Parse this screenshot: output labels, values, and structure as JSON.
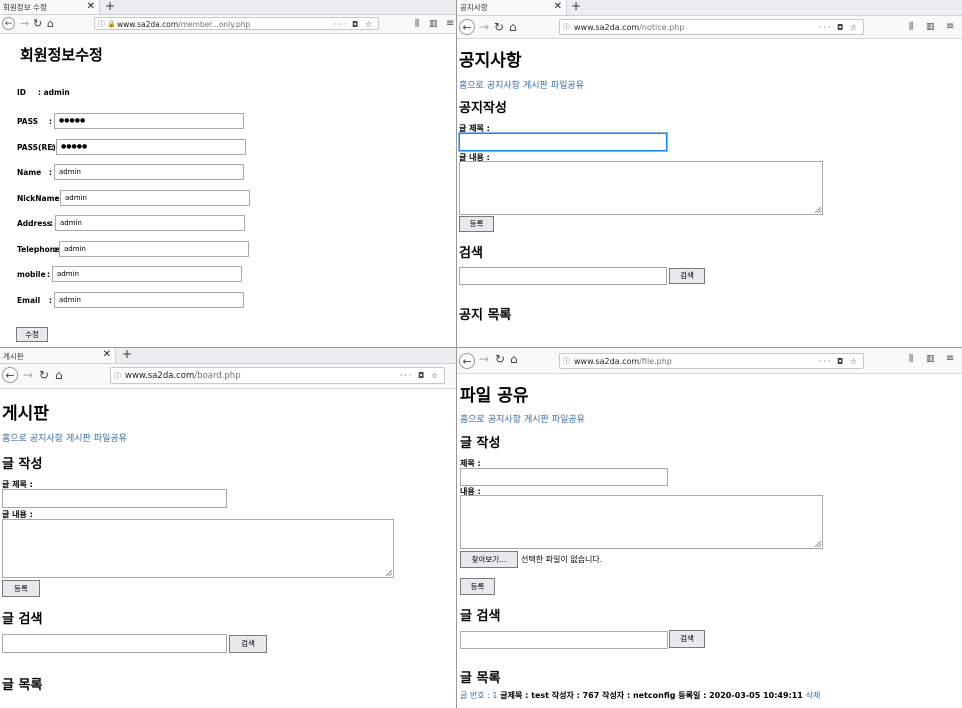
{
  "panes": {
    "member": {
      "tab_title": "회원정보 수정",
      "url_domain": "www.sa2da.com",
      "url_path": "/member...only.php",
      "page_title": "회원정보수정",
      "id_label": "ID",
      "id_value": ": admin",
      "fields": [
        {
          "label": "PASS",
          "sep": ":",
          "value": "●●●●●"
        },
        {
          "label": "PASS(RE)",
          "sep": ":",
          "value": "●●●●●"
        },
        {
          "label": "Name",
          "sep": ":",
          "value": "admin"
        },
        {
          "label": "NickName",
          "sep": ":",
          "value": "admin"
        },
        {
          "label": "Address",
          "sep": ":",
          "value": "admin"
        },
        {
          "label": "Telephone",
          "sep": ":",
          "value": "admin"
        },
        {
          "label": "mobile",
          "sep": ":",
          "value": "admin"
        },
        {
          "label": "Email",
          "sep": ":",
          "value": "admin"
        }
      ],
      "submit_label": "수정"
    },
    "notice": {
      "tab_title": "공지사항",
      "url_domain": "www.sa2da.com",
      "url_path": "/notice.php",
      "page_title": "공지사항",
      "nav": [
        "홈으로",
        "공지사항",
        "게시판",
        "파일공유"
      ],
      "write_heading": "공지작성",
      "title_label": "글 제목 :",
      "content_label": "글 내용 :",
      "submit_label": "등록",
      "search_heading": "검색",
      "search_button": "검색",
      "list_heading": "공지 목록"
    },
    "board": {
      "tab_title": "게시판",
      "url_domain": "www.sa2da.com",
      "url_path": "/board.php",
      "page_title": "게시판",
      "nav": [
        "홈으로",
        "공지사항",
        "게시판",
        "파일공유"
      ],
      "write_heading": "글 작성",
      "title_label": "글 제목 :",
      "content_label": "글 내용 :",
      "submit_label": "등록",
      "search_heading": "글 검색",
      "search_button": "검색",
      "list_heading": "글 목록"
    },
    "file": {
      "url_domain": "www.sa2da.com",
      "url_path": "/file.php",
      "page_title": "파일 공유",
      "nav": [
        "홈으로",
        "공지사항",
        "게시판",
        "파일공유"
      ],
      "write_heading": "글 작성",
      "title_label": "제목 :",
      "content_label": "내용 :",
      "browse_button": "찾아보기...",
      "no_file_text": "선택한 파일이 없습니다.",
      "submit_label": "등록",
      "search_heading": "글 검색",
      "search_button": "검색",
      "list_heading": "글 목록",
      "rows": [
        {
          "no_label": "글 번호 : 1",
          "text": " 글제목 : test 작성자 : 767 작성자 : netconfig 등록일 : 2020-03-05 10:49:11 ",
          "delete_label": "삭제"
        }
      ]
    }
  },
  "colors": {
    "link": "#3a6ea5",
    "focus": "#0a84ff"
  }
}
